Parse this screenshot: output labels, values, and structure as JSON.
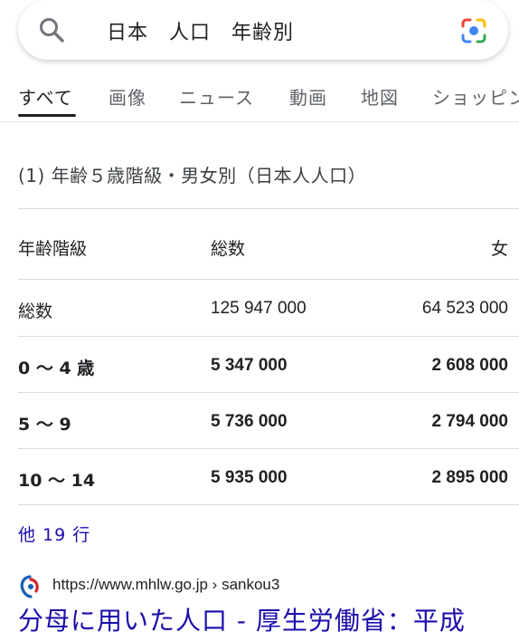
{
  "search": {
    "query": "日本　人口　年齢別"
  },
  "tabs": [
    {
      "label": "すべて",
      "active": true
    },
    {
      "label": "画像",
      "active": false
    },
    {
      "label": "ニュース",
      "active": false
    },
    {
      "label": "動画",
      "active": false
    },
    {
      "label": "地図",
      "active": false
    },
    {
      "label": "ショッピン",
      "active": false
    }
  ],
  "table": {
    "caption": "(1) 年齢５歳階級・男女別（日本人人口）",
    "headers": [
      "年齢階級",
      "総数",
      "女"
    ],
    "rows": [
      {
        "age": "総数",
        "total": "125 947 000",
        "female": "64 523 000",
        "bold": false
      },
      {
        "age": "0 〜 4 歳",
        "total": "5 347 000",
        "female": "2 608 000",
        "bold": true
      },
      {
        "age": "5 〜 9",
        "total": "5 736 000",
        "female": "2 794 000",
        "bold": true
      },
      {
        "age": "10 〜 14",
        "total": "5 935 000",
        "female": "2 895 000",
        "bold": true
      }
    ],
    "more_rows_label": "他 19 行"
  },
  "result": {
    "url": "https://www.mhlw.go.jp › sankou3",
    "title": "分母に用いた人口 - 厚生労働省：平成"
  },
  "colors": {
    "link": "#1a0dab",
    "text": "#202124",
    "muted": "#5f6368"
  },
  "icons": {
    "search": "search-icon",
    "lens": "google-lens-icon",
    "favicon": "mhlw-favicon"
  }
}
